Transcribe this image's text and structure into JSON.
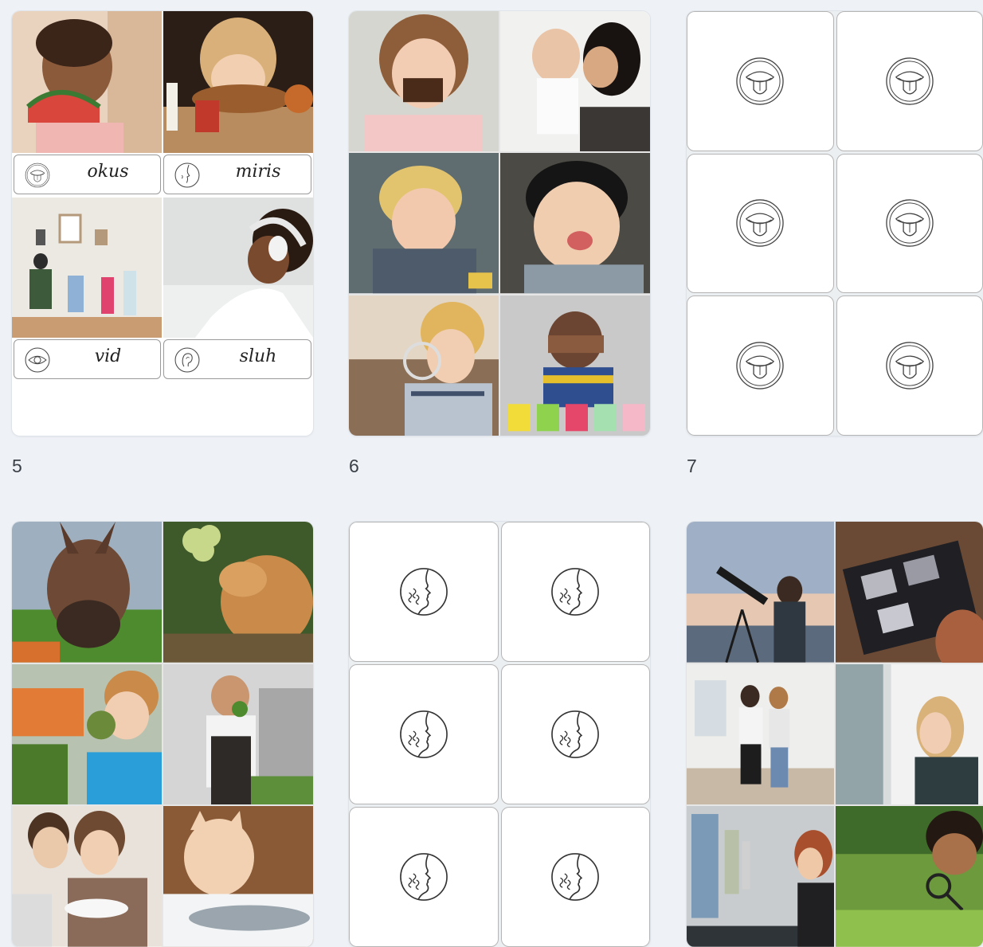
{
  "pages": [
    {
      "number": ""
    },
    {
      "number": ""
    },
    {
      "number": ""
    },
    {
      "number": "5"
    },
    {
      "number": "6"
    },
    {
      "number": "7"
    }
  ],
  "page4": {
    "labels": [
      {
        "icon": "tongue-icon",
        "word": "okus"
      },
      {
        "icon": "nose-icon",
        "word": "miris"
      },
      {
        "icon": "eye-icon",
        "word": "vid"
      },
      {
        "icon": "ear-icon",
        "word": "sluh"
      }
    ],
    "photos": [
      "child-eating-watermelon",
      "child-smelling-bread",
      "children-looking-at-pictures",
      "girl-listening-headphones"
    ]
  },
  "page5": {
    "photos": [
      "girl-eating-chocolate-cake",
      "mother-kissing-baby",
      "boy-tasting-sour",
      "boy-licking-finger",
      "boy-licking-whisk",
      "boy-covering-eyes-ice-cream"
    ]
  },
  "page6": {
    "symbol": "tongue-icon",
    "count": 6
  },
  "page8": {
    "photos": [
      "donkey-sniffing-grass",
      "dog-sniffing-grapes",
      "boy-smelling-artichoke",
      "chef-smelling-herbs",
      "couple-smelling-food",
      "kitten-sniffing-fish"
    ]
  },
  "page9": {
    "symbol": "smelling-face-icon",
    "count": 6
  },
  "page10": {
    "photos": [
      "people-with-telescope",
      "person-looking-at-photo-album",
      "couple-in-gallery",
      "woman-looking-out-window",
      "woman-viewing-art",
      "boy-with-magnifying-glass"
    ]
  },
  "colors": {
    "background": "#eef2f6",
    "card": "#ffffff",
    "line": "#b5b5b5",
    "text": "#3a3f47"
  }
}
